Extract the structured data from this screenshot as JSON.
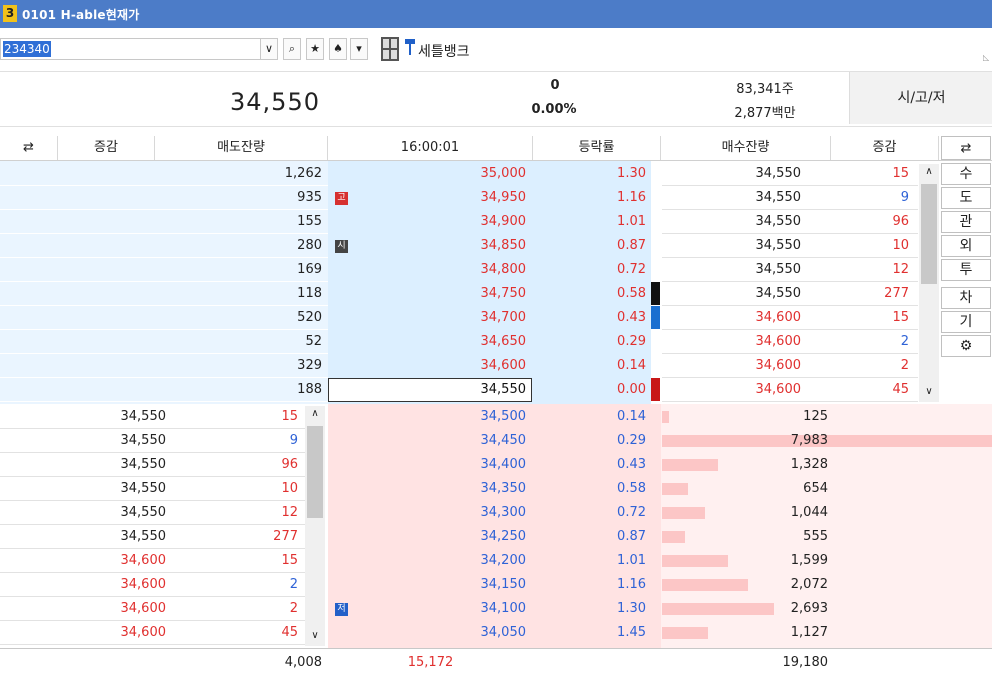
{
  "window": {
    "number": "3",
    "title": "0101 H-able현재가"
  },
  "toolbar": {
    "code": "234340",
    "stock_name": "세틀뱅크",
    "logo_text": "세틀뱅크",
    "buttons": [
      "∨",
      "⌕",
      "★",
      "♠",
      "▾"
    ]
  },
  "summary": {
    "price": "34,550",
    "change": "0",
    "change_rate": "0.00%",
    "volume": "83,341주",
    "amount": "2,877백만",
    "sigo_label": "시/고/저"
  },
  "headers": {
    "left_change": "증감",
    "ask_qty": "매도잔량",
    "time": "16:00:01",
    "rate": "등락률",
    "bid_qty": "매수잔량",
    "right_change": "증감"
  },
  "asks": [
    {
      "qty": "1,262",
      "price": "35,000",
      "rate": "1.30",
      "badge": ""
    },
    {
      "qty": "935",
      "price": "34,950",
      "rate": "1.16",
      "badge": "고"
    },
    {
      "qty": "155",
      "price": "34,900",
      "rate": "1.01",
      "badge": ""
    },
    {
      "qty": "280",
      "price": "34,850",
      "rate": "0.87",
      "badge": "시"
    },
    {
      "qty": "169",
      "price": "34,800",
      "rate": "0.72",
      "badge": ""
    },
    {
      "qty": "118",
      "price": "34,750",
      "rate": "0.58",
      "badge": ""
    },
    {
      "qty": "520",
      "price": "34,700",
      "rate": "0.43",
      "badge": ""
    },
    {
      "qty": "52",
      "price": "34,650",
      "rate": "0.29",
      "badge": ""
    },
    {
      "qty": "329",
      "price": "34,600",
      "rate": "0.14",
      "badge": ""
    },
    {
      "qty": "188",
      "price": "34,550",
      "rate": "0.00",
      "badge": ""
    }
  ],
  "bids": [
    {
      "price": "34,500",
      "rate": "0.14",
      "qty": "125",
      "bar": 0.02,
      "badge": ""
    },
    {
      "price": "34,450",
      "rate": "0.29",
      "qty": "7,983",
      "bar": 1.0,
      "badge": ""
    },
    {
      "price": "34,400",
      "rate": "0.43",
      "qty": "1,328",
      "bar": 0.17,
      "badge": ""
    },
    {
      "price": "34,350",
      "rate": "0.58",
      "qty": "654",
      "bar": 0.08,
      "badge": ""
    },
    {
      "price": "34,300",
      "rate": "0.72",
      "qty": "1,044",
      "bar": 0.13,
      "badge": ""
    },
    {
      "price": "34,250",
      "rate": "0.87",
      "qty": "555",
      "bar": 0.07,
      "badge": ""
    },
    {
      "price": "34,200",
      "rate": "1.01",
      "qty": "1,599",
      "bar": 0.2,
      "badge": ""
    },
    {
      "price": "34,150",
      "rate": "1.16",
      "qty": "2,072",
      "bar": 0.26,
      "badge": ""
    },
    {
      "price": "34,100",
      "rate": "1.30",
      "qty": "2,693",
      "bar": 0.34,
      "badge": "저"
    },
    {
      "price": "34,050",
      "rate": "1.45",
      "qty": "1,127",
      "bar": 0.14,
      "badge": ""
    }
  ],
  "trades_right": [
    {
      "price": "34,550",
      "qty": "15",
      "price_color": "black"
    },
    {
      "price": "34,550",
      "qty": "9",
      "price_color": "black"
    },
    {
      "price": "34,550",
      "qty": "96",
      "price_color": "black"
    },
    {
      "price": "34,550",
      "qty": "10",
      "price_color": "black"
    },
    {
      "price": "34,550",
      "qty": "12",
      "price_color": "black"
    },
    {
      "price": "34,550",
      "qty": "277",
      "price_color": "black"
    },
    {
      "price": "34,600",
      "qty": "15",
      "price_color": "red"
    },
    {
      "price": "34,600",
      "qty": "2",
      "price_color": "red"
    },
    {
      "price": "34,600",
      "qty": "2",
      "price_color": "red"
    },
    {
      "price": "34,600",
      "qty": "45",
      "price_color": "red"
    }
  ],
  "trades_left": [
    {
      "price": "34,550",
      "qty": "15",
      "qty_color": "red",
      "price_color": "black"
    },
    {
      "price": "34,550",
      "qty": "9",
      "qty_color": "blue",
      "price_color": "black"
    },
    {
      "price": "34,550",
      "qty": "96",
      "qty_color": "red",
      "price_color": "black"
    },
    {
      "price": "34,550",
      "qty": "10",
      "qty_color": "red",
      "price_color": "black"
    },
    {
      "price": "34,550",
      "qty": "12",
      "qty_color": "red",
      "price_color": "black"
    },
    {
      "price": "34,550",
      "qty": "277",
      "qty_color": "red",
      "price_color": "black"
    },
    {
      "price": "34,600",
      "qty": "15",
      "qty_color": "red",
      "price_color": "red"
    },
    {
      "price": "34,600",
      "qty": "2",
      "qty_color": "blue",
      "price_color": "red"
    },
    {
      "price": "34,600",
      "qty": "2",
      "qty_color": "red",
      "price_color": "red"
    },
    {
      "price": "34,600",
      "qty": "45",
      "qty_color": "red",
      "price_color": "red"
    }
  ],
  "side_buttons": [
    "수",
    "도",
    "관",
    "외",
    "투",
    "차",
    "기",
    "⚙"
  ],
  "footer": {
    "ask_total": "4,008",
    "diff": "15,172",
    "bid_total": "19,180"
  },
  "colors": {
    "title": "#4c7cc8",
    "ask_bg": "#dcefff",
    "bid_bg": "#ffe3e3",
    "up": "#e0302f",
    "down": "#2e62d6"
  }
}
